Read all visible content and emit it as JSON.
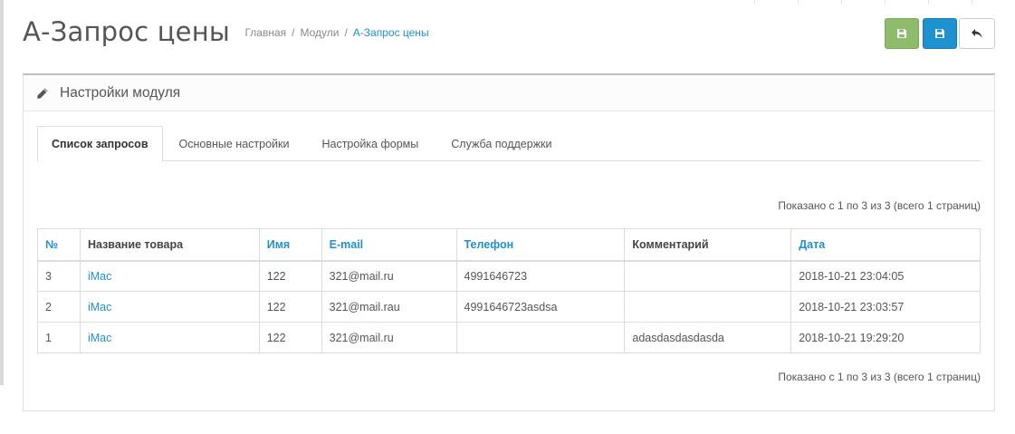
{
  "header": {
    "title": "А-Запрос цены",
    "breadcrumb": [
      {
        "label": "Главная"
      },
      {
        "label": "Модули"
      },
      {
        "label": "А-Запрос цены"
      }
    ],
    "separator": "/",
    "buttons": {
      "save_stay": "save-icon",
      "save": "save-icon",
      "back": "reply-icon"
    }
  },
  "panel": {
    "title": "Настройки модуля",
    "icon": "pencil-icon"
  },
  "tabs": [
    {
      "label": "Список запросов",
      "active": true
    },
    {
      "label": "Основные настройки",
      "active": false
    },
    {
      "label": "Настройка формы",
      "active": false
    },
    {
      "label": "Служба поддержки",
      "active": false
    }
  ],
  "pagination_text": "Показано с 1 по 3 из 3 (всего 1 страниц)",
  "table": {
    "columns": [
      {
        "label": "№",
        "sortable": true
      },
      {
        "label": "Название товара",
        "sortable": false
      },
      {
        "label": "Имя",
        "sortable": true
      },
      {
        "label": "E-mail",
        "sortable": true
      },
      {
        "label": "Телефон",
        "sortable": true
      },
      {
        "label": "Комментарий",
        "sortable": false
      },
      {
        "label": "Дата",
        "sortable": true
      }
    ],
    "rows": [
      {
        "id": "3",
        "product": "iMac",
        "name": "122",
        "email": "321@mail.ru",
        "phone": "4991646723",
        "comment": "",
        "date": "2018-10-21 23:04:05"
      },
      {
        "id": "2",
        "product": "iMac",
        "name": "122",
        "email": "321@mail.rau",
        "phone": "4991646723asdsa",
        "comment": "",
        "date": "2018-10-21 23:03:57"
      },
      {
        "id": "1",
        "product": "iMac",
        "name": "122",
        "email": "321@mail.ru",
        "phone": "",
        "comment": "adasdasdasdasda",
        "date": "2018-10-21 19:29:20"
      }
    ]
  },
  "colors": {
    "accent": "#1e91cf",
    "success": "#8fbb6c"
  }
}
